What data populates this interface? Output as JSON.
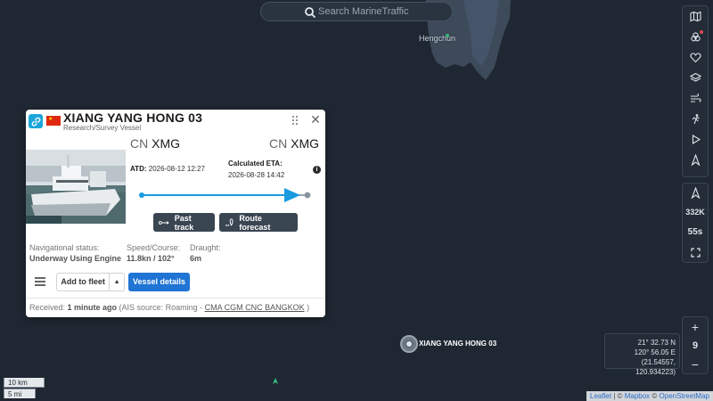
{
  "search": {
    "placeholder": "Search MarineTraffic"
  },
  "map": {
    "town_label": "Hengchun",
    "vessel_label": "XIANG YANG HONG 03",
    "scale_km": "10 km",
    "scale_mi": "5 mi",
    "attribution": {
      "leaflet": "Leaflet",
      "sep1": " | © ",
      "mapbox": "Mapbox",
      "sep2": " © ",
      "osm": "OpenStreetMap"
    }
  },
  "right_rail": {
    "tools": [
      "map-icon",
      "filters-icon",
      "favorites-icon",
      "layers-icon",
      "weather-icon",
      "measure-icon",
      "play-icon",
      "compass-icon"
    ],
    "count_label": "332K",
    "refresh_label": "55s",
    "zoom_level": "9"
  },
  "coordinates": {
    "lat": "21° 32.73 N",
    "lon": "120° 56.05 E",
    "decimal": "(21.54557, 120.934223)"
  },
  "popup": {
    "vessel_name": "XIANG YANG HONG 03",
    "vessel_type": "Research/Survey Vessel",
    "flag_country": "China",
    "from": {
      "country_code": "CN",
      "port_code": "XMG"
    },
    "to": {
      "country_code": "CN",
      "port_code": "XMG"
    },
    "atd_label": "ATD:",
    "atd_value": "2026-08-12 12:27",
    "eta_label": "Calculated ETA:",
    "eta_value": "2026-08-28 14:42",
    "past_track_label": "Past track",
    "route_forecast_label": "Route forecast",
    "nav_status_label": "Navigational status:",
    "nav_status_value": "Underway Using Engine",
    "speed_label": "Speed/Course:",
    "speed_value": "11.8kn / 102°",
    "draught_label": "Draught:",
    "draught_value": "6m",
    "add_fleet_label": "Add to fleet",
    "vessel_details_label": "Vessel details",
    "received_prefix": "Received: ",
    "received_time": "1 minute ago",
    "received_source_prefix": " (AIS source: Roaming - ",
    "received_source": "CMA CGM CNC BANGKOK",
    "received_suffix": " )"
  },
  "colors": {
    "map_bg": "#1f2732",
    "land": "#3d4a59",
    "accent_blue": "#1f74d4",
    "route_line": "#1a9ae0",
    "flag_red": "#de2910"
  }
}
